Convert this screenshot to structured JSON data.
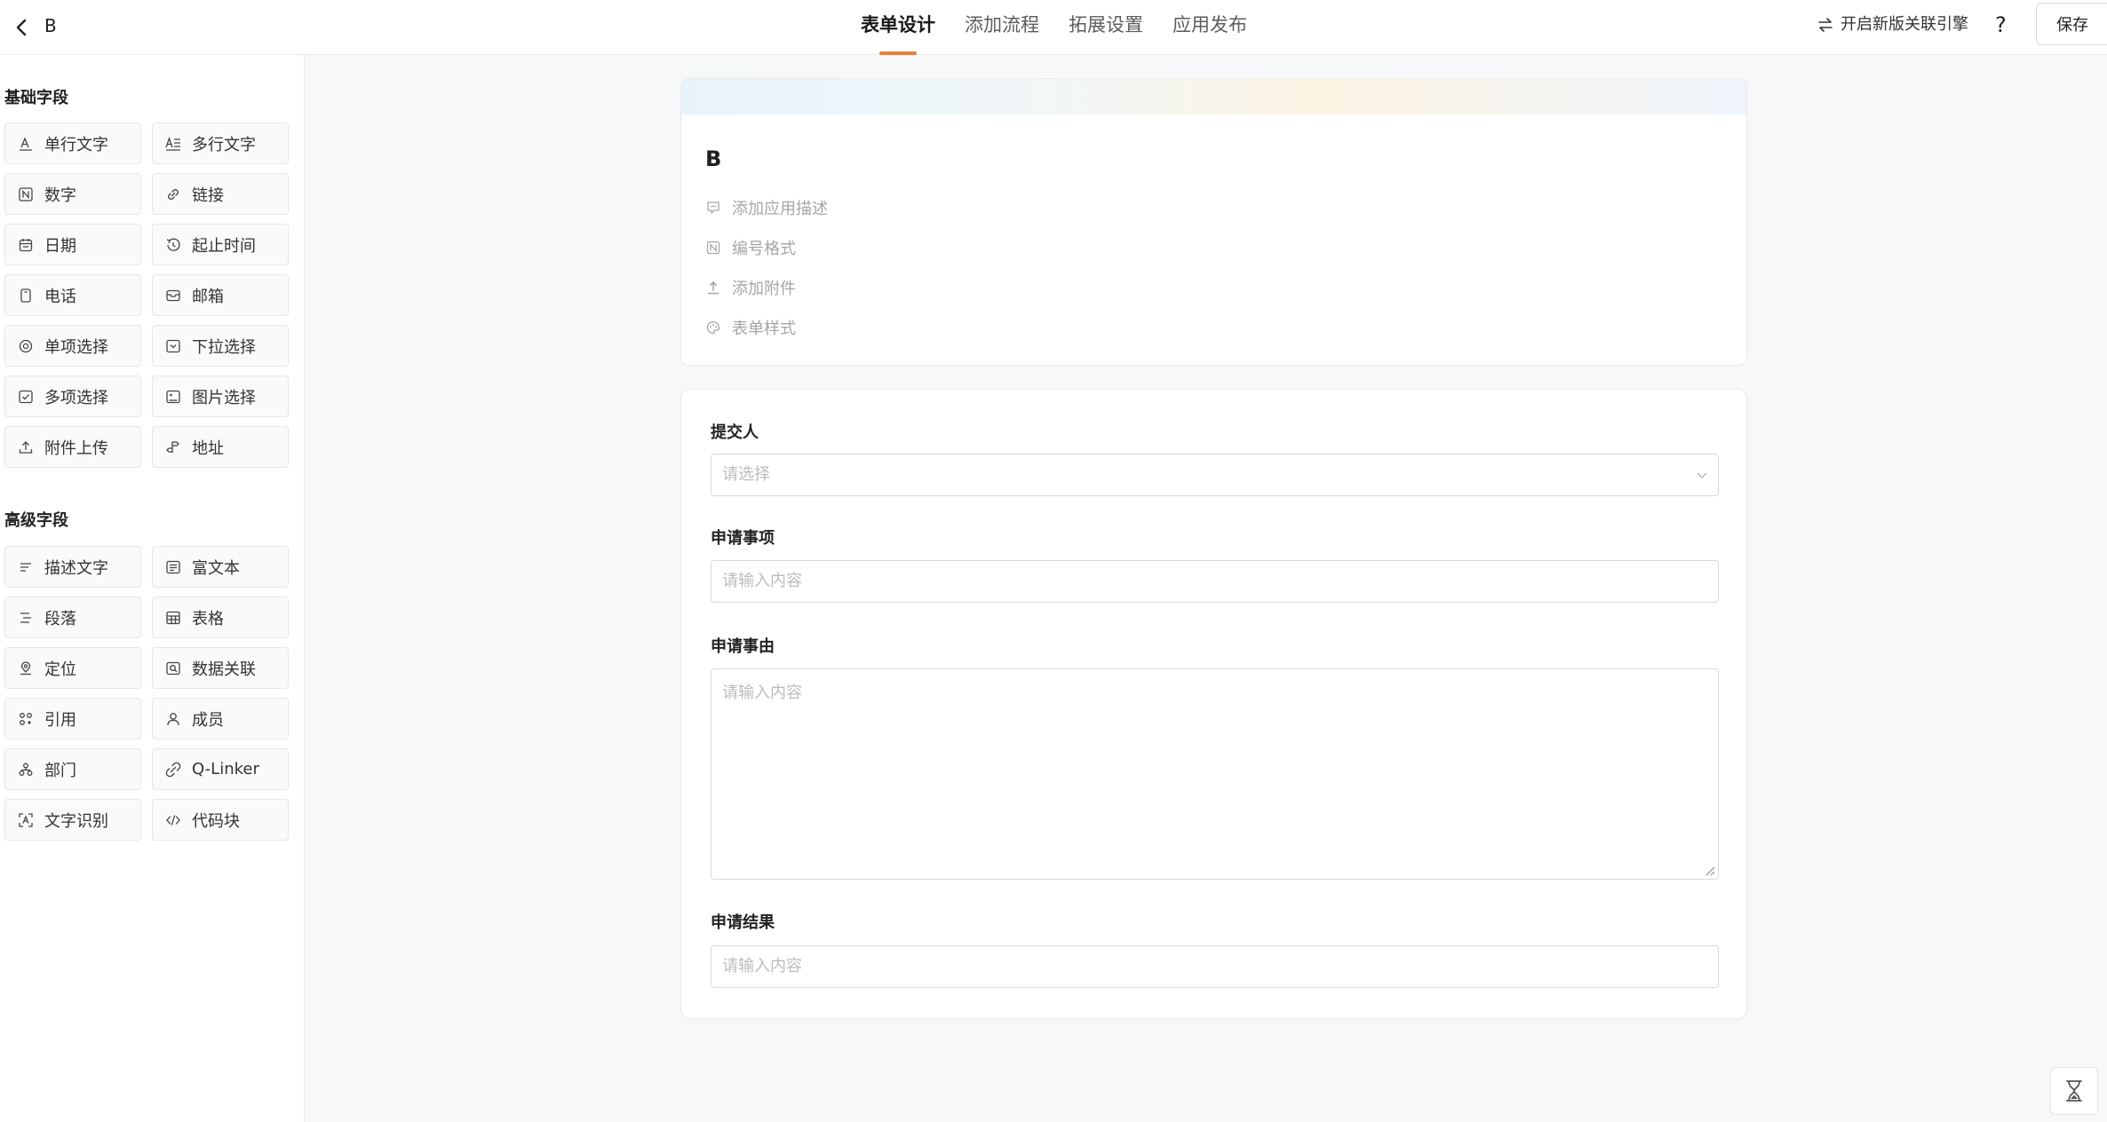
{
  "header": {
    "app_name": "B",
    "tabs": [
      {
        "label": "表单设计",
        "active": true
      },
      {
        "label": "添加流程",
        "active": false
      },
      {
        "label": "拓展设置",
        "active": false
      },
      {
        "label": "应用发布",
        "active": false
      }
    ],
    "engine_link": "开启新版关联引擎",
    "help": "?",
    "save_label": "保存",
    "accent_color": "#e8803a"
  },
  "sidebar": {
    "basic_title": "基础字段",
    "basic_fields": [
      {
        "label": "单行文字",
        "icon": "single-line-text-icon"
      },
      {
        "label": "多行文字",
        "icon": "multi-line-text-icon"
      },
      {
        "label": "数字",
        "icon": "number-icon"
      },
      {
        "label": "链接",
        "icon": "link-icon"
      },
      {
        "label": "日期",
        "icon": "calendar-icon"
      },
      {
        "label": "起止时间",
        "icon": "time-range-icon"
      },
      {
        "label": "电话",
        "icon": "phone-icon"
      },
      {
        "label": "邮箱",
        "icon": "mail-icon"
      },
      {
        "label": "单项选择",
        "icon": "radio-icon"
      },
      {
        "label": "下拉选择",
        "icon": "dropdown-icon"
      },
      {
        "label": "多项选择",
        "icon": "checkbox-icon"
      },
      {
        "label": "图片选择",
        "icon": "image-icon"
      },
      {
        "label": "附件上传",
        "icon": "upload-icon"
      },
      {
        "label": "地址",
        "icon": "address-icon"
      }
    ],
    "advanced_title": "高级字段",
    "advanced_fields": [
      {
        "label": "描述文字",
        "icon": "description-icon"
      },
      {
        "label": "富文本",
        "icon": "rich-text-icon"
      },
      {
        "label": "段落",
        "icon": "paragraph-icon"
      },
      {
        "label": "表格",
        "icon": "table-icon"
      },
      {
        "label": "定位",
        "icon": "location-icon"
      },
      {
        "label": "数据关联",
        "icon": "data-link-icon"
      },
      {
        "label": "引用",
        "icon": "reference-icon"
      },
      {
        "label": "成员",
        "icon": "member-icon"
      },
      {
        "label": "部门",
        "icon": "department-icon"
      },
      {
        "label": "Q-Linker",
        "icon": "q-linker-icon"
      },
      {
        "label": "文字识别",
        "icon": "ocr-icon"
      },
      {
        "label": "代码块",
        "icon": "code-icon"
      }
    ]
  },
  "form_header": {
    "title": "B",
    "actions": [
      {
        "label": "添加应用描述",
        "icon": "comment-icon"
      },
      {
        "label": "编号格式",
        "icon": "number-format-icon"
      },
      {
        "label": "添加附件",
        "icon": "attachment-upload-icon"
      },
      {
        "label": "表单样式",
        "icon": "palette-icon"
      }
    ]
  },
  "form": {
    "fields": [
      {
        "label": "提交人",
        "type": "select",
        "placeholder": "请选择"
      },
      {
        "label": "申请事项",
        "type": "input",
        "placeholder": "请输入内容"
      },
      {
        "label": "申请事由",
        "type": "textarea",
        "placeholder": "请输入内容"
      },
      {
        "label": "申请结果",
        "type": "input",
        "placeholder": "请输入内容"
      }
    ]
  }
}
